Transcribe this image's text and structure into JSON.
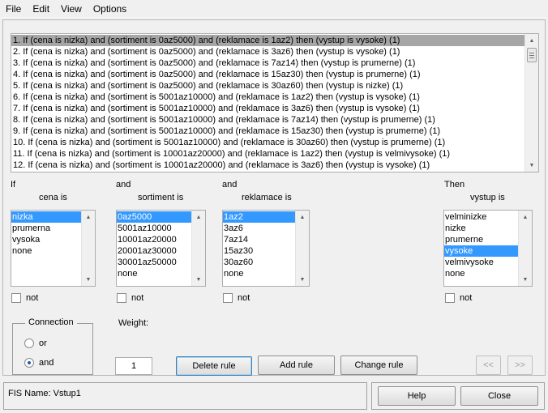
{
  "menu": [
    "File",
    "Edit",
    "View",
    "Options"
  ],
  "rules": [
    "1. If (cena is nizka) and (sortiment is 0az5000) and (reklamace is 1az2) then (vystup is vysoke) (1)",
    "2. If (cena is nizka) and (sortiment is 0az5000) and (reklamace is 3az6) then (vystup is vysoke) (1)",
    "3. If (cena is nizka) and (sortiment is 0az5000) and (reklamace is 7az14) then (vystup is prumerne) (1)",
    "4. If (cena is nizka) and (sortiment is 0az5000) and (reklamace is 15az30) then (vystup is prumerne) (1)",
    "5. If (cena is nizka) and (sortiment is 0az5000) and (reklamace is 30az60) then (vystup is nizke) (1)",
    "6. If (cena is nizka) and (sortiment is 5001az10000) and (reklamace is 1az2) then (vystup is vysoke) (1)",
    "7. If (cena is nizka) and (sortiment is 5001az10000) and (reklamace is 3az6) then (vystup is vysoke) (1)",
    "8. If (cena is nizka) and (sortiment is 5001az10000) and (reklamace is 7az14) then (vystup is prumerne) (1)",
    "9. If (cena is nizka) and (sortiment is 5001az10000) and (reklamace is 15az30) then (vystup is prumerne) (1)",
    "10. If (cena is nizka) and (sortiment is 5001az10000) and (reklamace is 30az60) then (vystup is prumerne) (1)",
    "11. If (cena is nizka) and (sortiment is 10001az20000) and (reklamace is 1az2) then (vystup is velmivysoke) (1)",
    "12. If (cena is nizka) and (sortiment is 10001az20000) and (reklamace is 3az6) then (vystup is vysoke) (1)"
  ],
  "antecedents": {
    "if_label": "If",
    "and_label_1": "and",
    "and_label_2": "and",
    "then_label": "Then",
    "cena": {
      "title": "cena is",
      "options": [
        "nizka",
        "prumerna",
        "vysoka",
        "none"
      ],
      "selected": 0
    },
    "sortiment": {
      "title": "sortiment is",
      "options": [
        "0az5000",
        "5001az10000",
        "10001az20000",
        "20001az30000",
        "30001az50000",
        "none"
      ],
      "selected": 0
    },
    "reklamace": {
      "title": "reklamace is",
      "options": [
        "1az2",
        "3az6",
        "7az14",
        "15az30",
        "30az60",
        "none"
      ],
      "selected": 0
    },
    "vystup": {
      "title": "vystup is",
      "options": [
        "velminizke",
        "nizke",
        "prumerne",
        "vysoke",
        "velmivysoke",
        "none"
      ],
      "selected": 3
    }
  },
  "not_label": "not",
  "connection": {
    "title": "Connection",
    "or": "or",
    "and": "and",
    "selected": "and"
  },
  "weight": {
    "label": "Weight:",
    "value": "1"
  },
  "buttons": {
    "delete": "Delete rule",
    "add": "Add rule",
    "change": "Change rule",
    "prev": "<<",
    "next": ">>",
    "help": "Help",
    "close": "Close"
  },
  "status": "FIS Name: Vstup1",
  "colors": {
    "selection": "#3399ff",
    "rule_selection": "#a6a6a6"
  }
}
